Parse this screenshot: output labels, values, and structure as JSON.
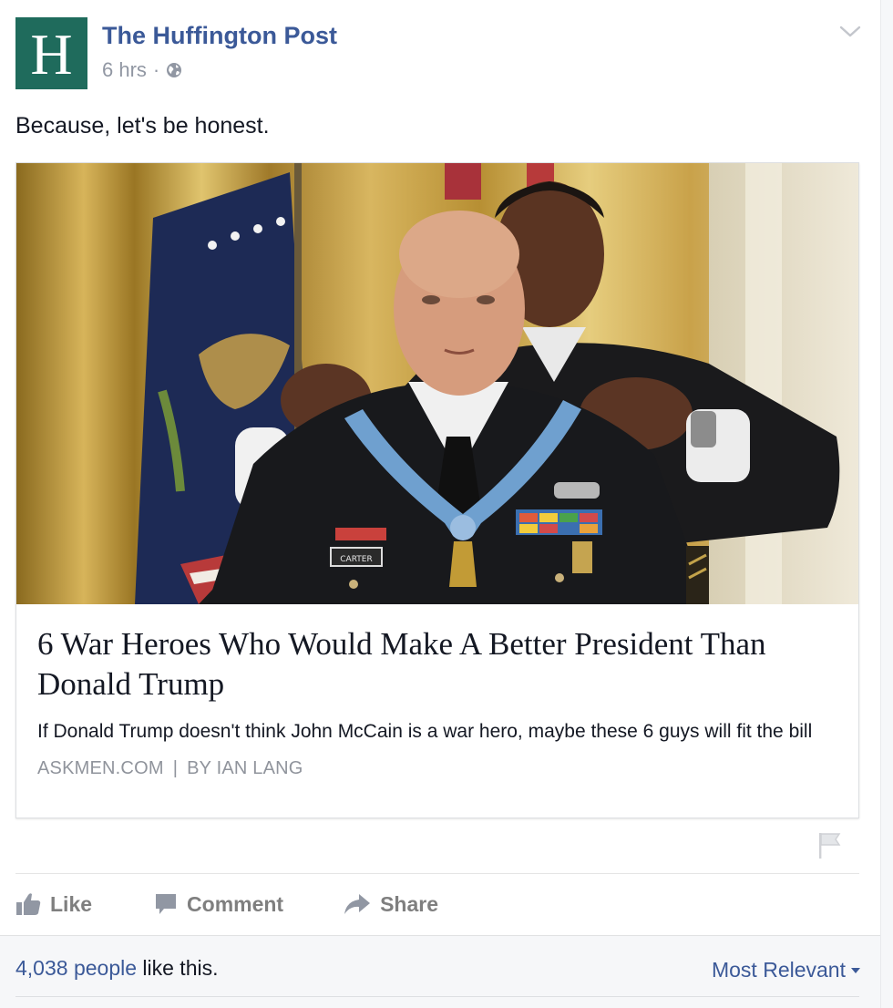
{
  "header": {
    "avatar_letter": "H",
    "page_name": "The Huffington Post",
    "time": "6 hrs",
    "dot": "·",
    "privacy_icon": "globe-icon",
    "menu_icon": "chevron-down-icon"
  },
  "post_text": "Because, let's be honest.",
  "link": {
    "title": "6 War Heroes Who Would Make A Better President Than Donald Trump",
    "description": "If Donald Trump doesn't think John McCain is a war hero, maybe these 6 guys will fit the bill",
    "source": "ASKMEN.COM",
    "separator": "|",
    "byline": "BY IAN LANG",
    "image_nametag": "CARTER"
  },
  "actions": {
    "like": "Like",
    "comment": "Comment",
    "share": "Share"
  },
  "footer": {
    "likes_count": "4,038 people",
    "likes_suffix": " like this.",
    "sort_label": "Most Relevant"
  },
  "colors": {
    "link_blue": "#3b5998",
    "avatar_green": "#1f6b5c",
    "muted_gray": "#9197a3",
    "action_gray": "#7f7f7f",
    "footer_bg": "#f6f7f9"
  }
}
